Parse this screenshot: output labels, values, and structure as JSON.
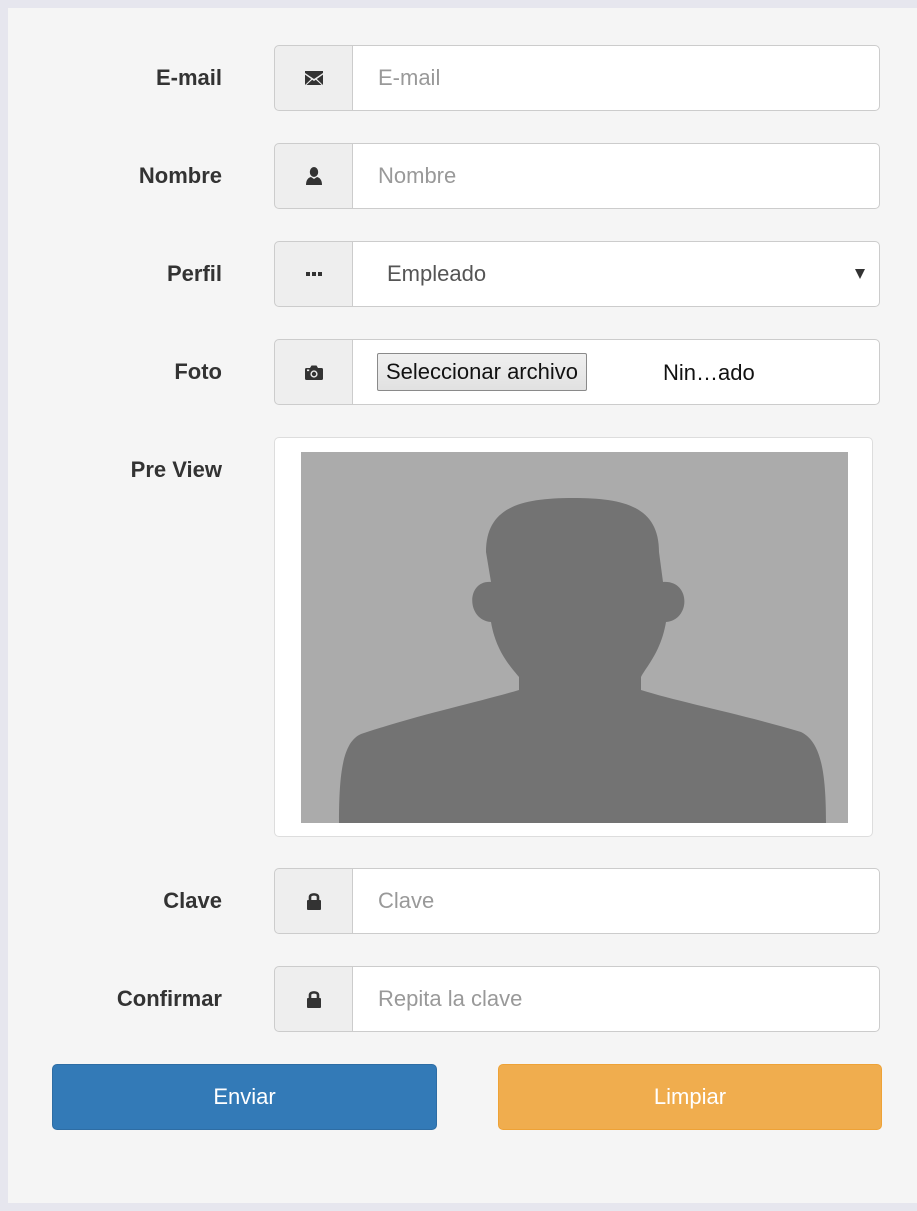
{
  "form": {
    "email": {
      "label": "E-mail",
      "placeholder": "E-mail",
      "value": "",
      "icon": "envelope-icon"
    },
    "nombre": {
      "label": "Nombre",
      "placeholder": "Nombre",
      "value": "",
      "icon": "user-icon"
    },
    "perfil": {
      "label": "Perfil",
      "selected": "Empleado",
      "icon": "ellipsis-icon"
    },
    "foto": {
      "label": "Foto",
      "button_label": "Seleccionar archivo",
      "status": "Nin…ado",
      "icon": "camera-icon"
    },
    "preview": {
      "label": "Pre View",
      "image": "person-silhouette-placeholder"
    },
    "clave": {
      "label": "Clave",
      "placeholder": "Clave",
      "value": "",
      "icon": "lock-icon"
    },
    "confirmar": {
      "label": "Confirmar",
      "placeholder": "Repita la clave",
      "value": "",
      "icon": "lock-icon"
    }
  },
  "buttons": {
    "submit_label": "Enviar",
    "clear_label": "Limpiar"
  },
  "colors": {
    "primary": "#337ab7",
    "warning": "#f0ad4e",
    "panel_bg": "#f5f5f5",
    "page_bg": "#e6e6ee",
    "addon_bg": "#eeeeee",
    "border": "#cccccc",
    "icon": "#333333",
    "preview_bg": "#ababab",
    "silhouette": "#737373"
  }
}
